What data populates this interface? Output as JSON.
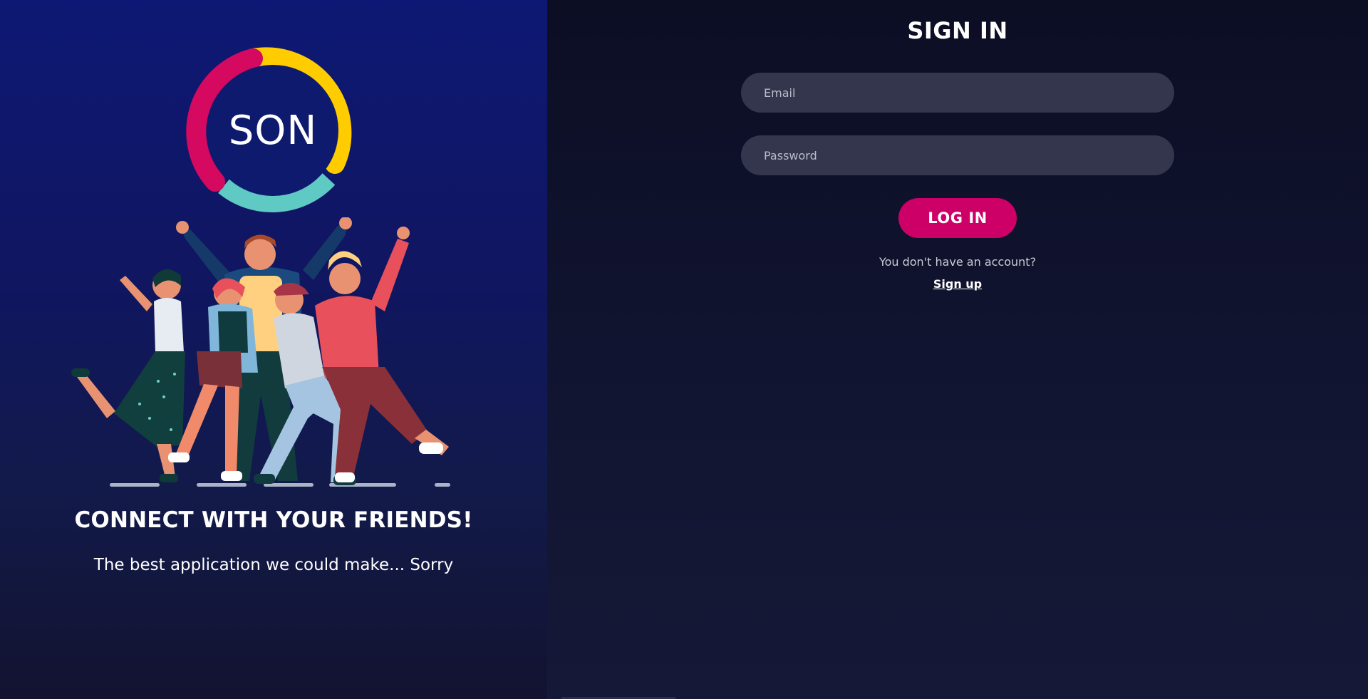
{
  "brand": {
    "logo_text": "SON",
    "colors": {
      "ring_magenta": "#d4095f",
      "ring_yellow": "#ffcc00",
      "ring_teal": "#5fc9c4",
      "accent": "#cc0066"
    }
  },
  "left": {
    "title": "CONNECT WITH YOUR FRIENDS!",
    "subtitle": "The best application we could make... Sorry"
  },
  "signin": {
    "title": "SIGN IN",
    "email_placeholder": "Email",
    "password_placeholder": "Password",
    "login_label": "LOG IN",
    "no_account_text": "You don't have an account?",
    "signup_label": "Sign up"
  }
}
